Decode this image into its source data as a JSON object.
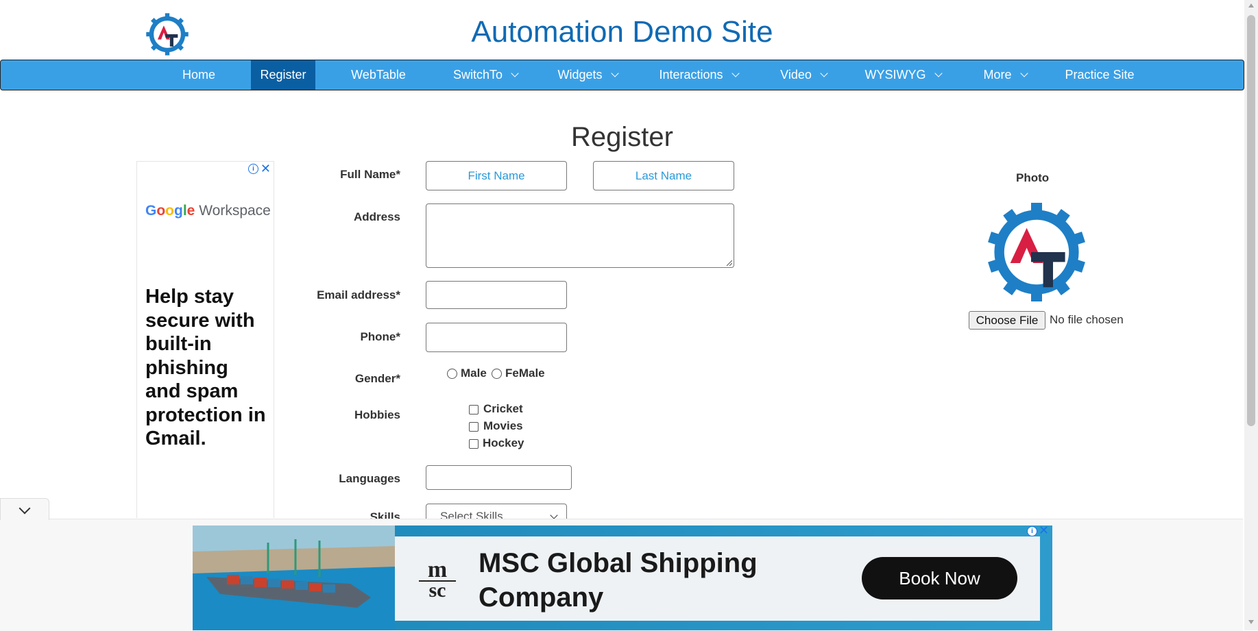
{
  "header": {
    "title": "Automation Demo Site",
    "logo_icon": "gear-at-logo-icon"
  },
  "nav": {
    "items": [
      {
        "label": "Home"
      },
      {
        "label": "Register"
      },
      {
        "label": "WebTable"
      },
      {
        "label": "SwitchTo"
      },
      {
        "label": "Widgets"
      },
      {
        "label": "Interactions"
      },
      {
        "label": "Video"
      },
      {
        "label": "WYSIWYG"
      },
      {
        "label": "More"
      },
      {
        "label": "Practice Site"
      }
    ],
    "active": "Register",
    "colors": {
      "bar": "#3aa0e6",
      "active": "#0a5fa3"
    }
  },
  "page": {
    "heading": "Register"
  },
  "side_ad": {
    "brand_google": "Google",
    "brand_workspace": "Workspace",
    "headline": "Help stay secure with built-in phishing and spam protection in Gmail.",
    "info_icon": "info-icon",
    "close_icon": "close-icon"
  },
  "form": {
    "full_name_label": "Full Name*",
    "first_name_placeholder": "First Name",
    "last_name_placeholder": "Last Name",
    "address_label": "Address",
    "email_label": "Email address*",
    "phone_label": "Phone*",
    "gender_label": "Gender*",
    "gender_options": [
      "Male",
      "FeMale"
    ],
    "hobbies_label": "Hobbies",
    "hobbies": [
      "Cricket",
      "Movies",
      "Hockey"
    ],
    "languages_label": "Languages",
    "skills_label": "Skills",
    "skills_placeholder": "Select Skills"
  },
  "photo": {
    "label": "Photo",
    "choose_file": "Choose File",
    "file_status": "No file chosen"
  },
  "bottom_ad": {
    "headline_line1": "MSC Global Shipping",
    "headline_line2": "Company",
    "cta": "Book Now",
    "logo_text_top": "m",
    "logo_text_bottom": "sc"
  }
}
